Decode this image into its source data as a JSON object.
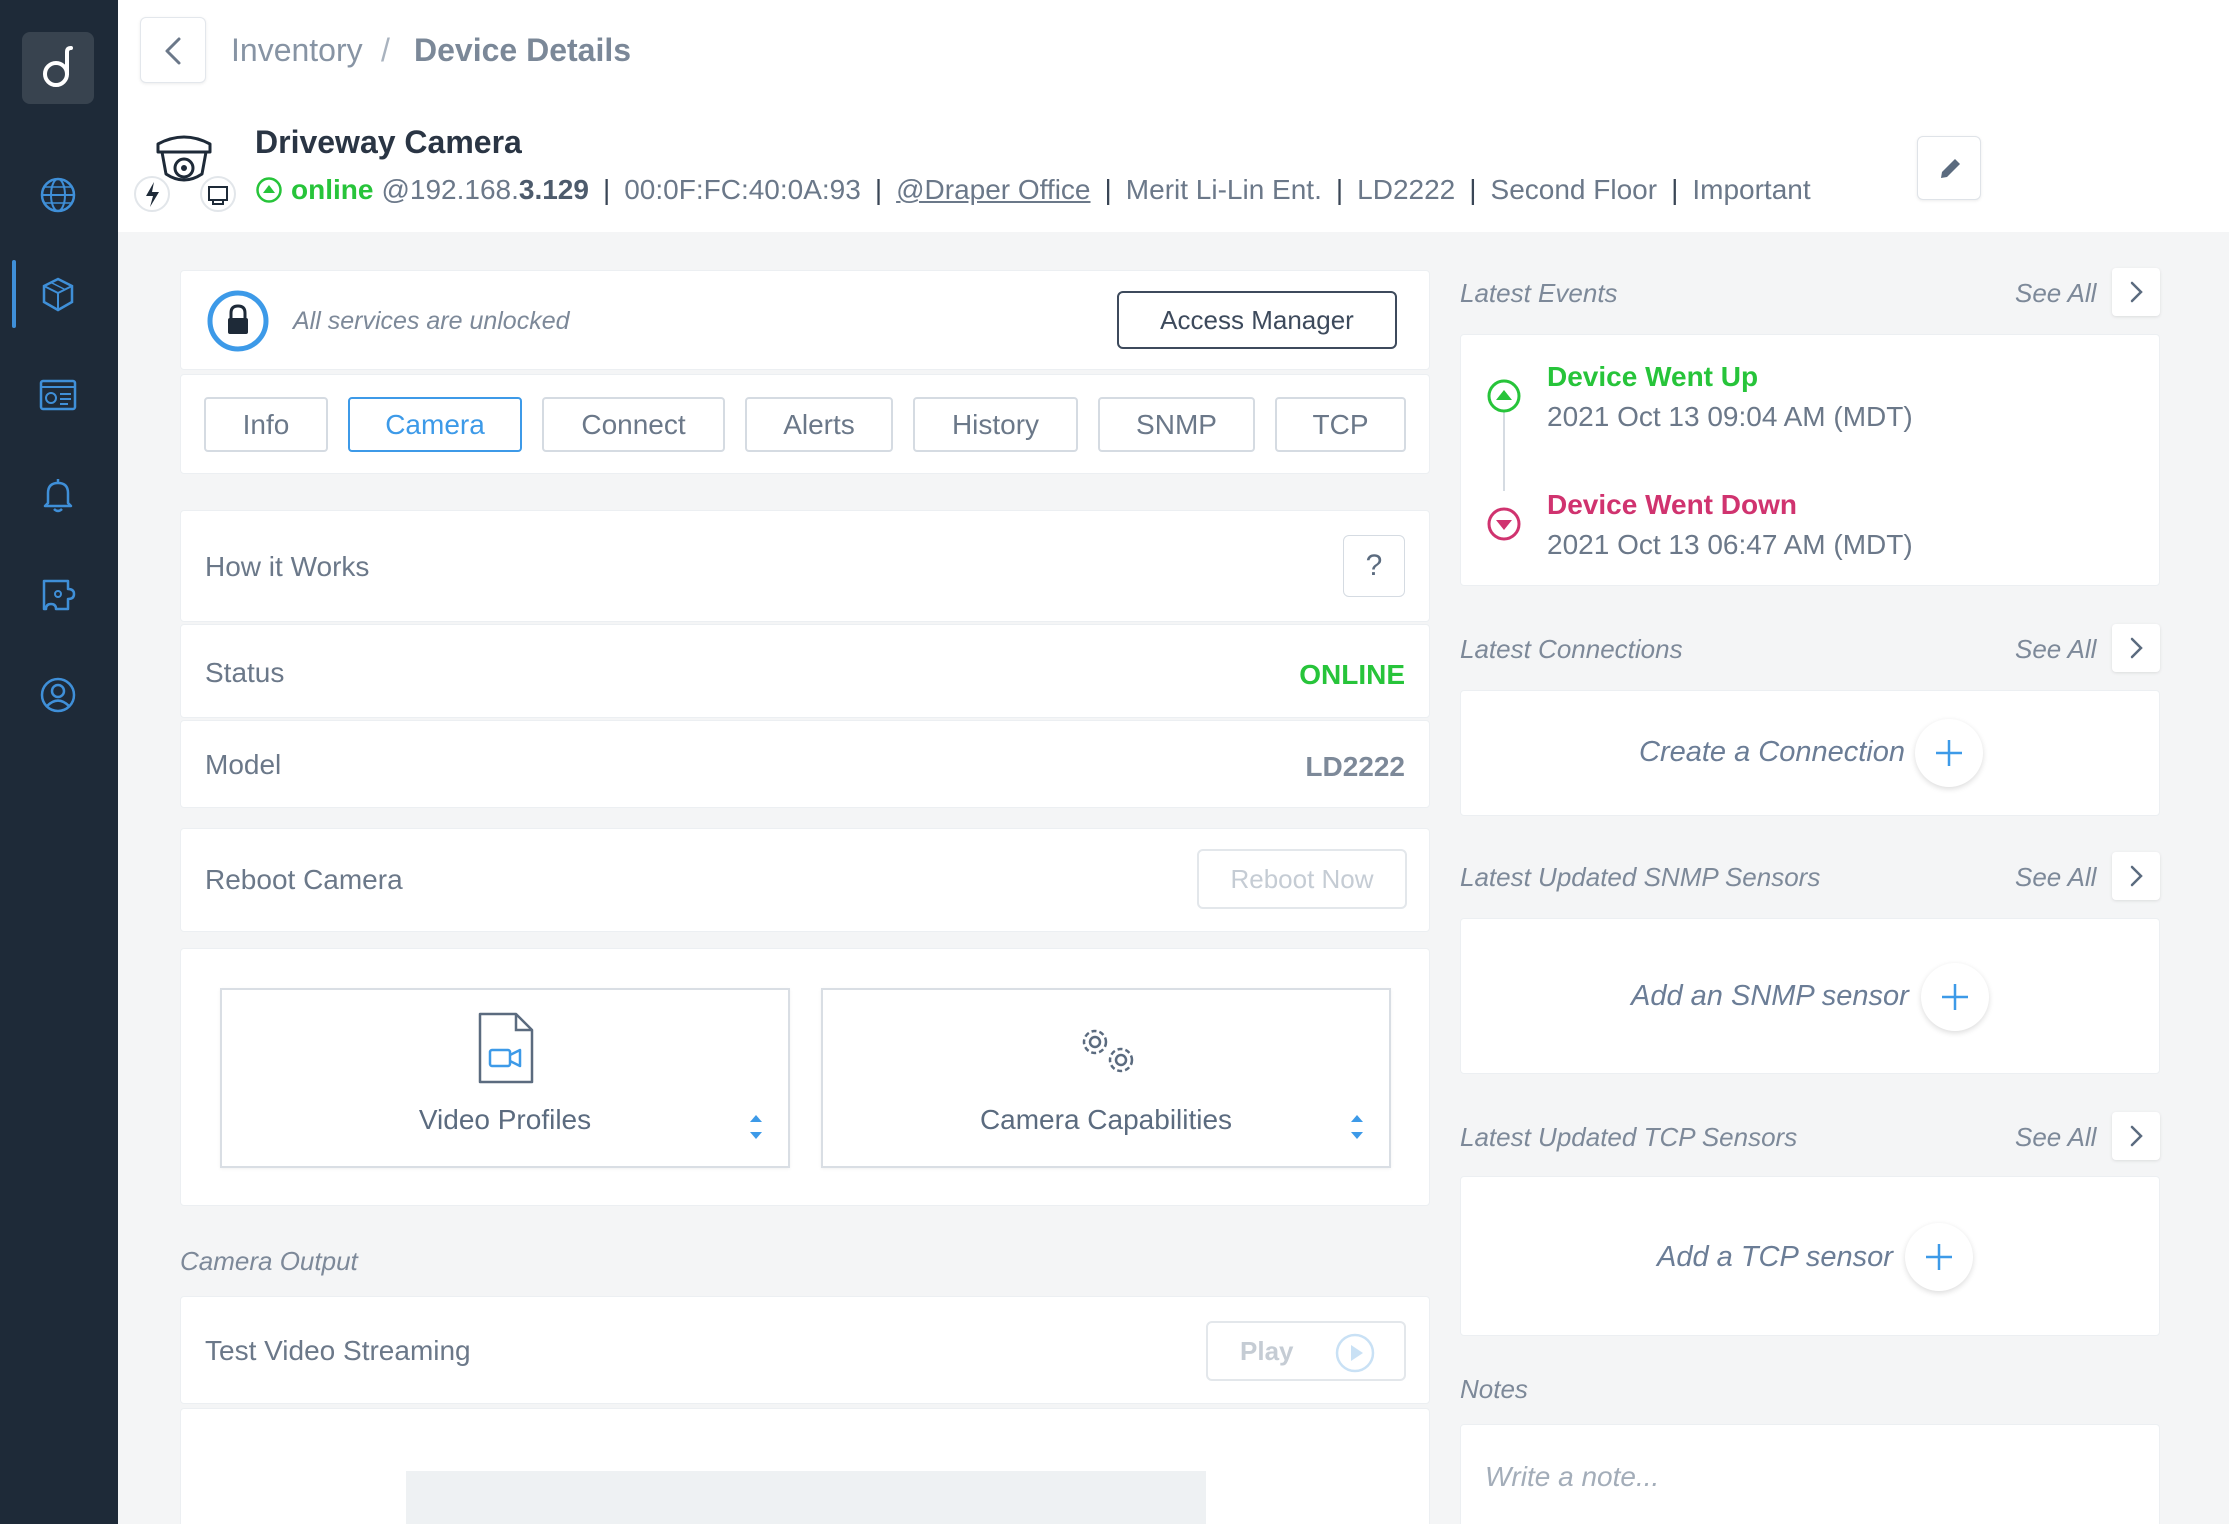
{
  "breadcrumb": {
    "parent": "Inventory",
    "separator": "/",
    "current": "Device Details"
  },
  "device": {
    "name": "Driveway Camera",
    "status": "online",
    "ip_prefix": "@192.168.",
    "ip_suffix": "3.129",
    "mac": "00:0F:FC:40:0A:93",
    "site": "@Draper Office",
    "vendor": "Merit Li-Lin Ent.",
    "model": "LD2222",
    "location": "Second Floor",
    "tag": "Important",
    "separator": "|"
  },
  "access": {
    "message": "All services are unlocked",
    "button": "Access Manager"
  },
  "tabs": [
    "Info",
    "Camera",
    "Connect",
    "Alerts",
    "History",
    "SNMP",
    "TCP"
  ],
  "active_tab": "Camera",
  "camera": {
    "how_it_works": "How it Works",
    "help_icon": "?",
    "status_label": "Status",
    "status_value": "ONLINE",
    "model_label": "Model",
    "model_value": "LD2222",
    "reboot_label": "Reboot Camera",
    "reboot_button": "Reboot Now",
    "video_profiles": "Video Profiles",
    "camera_capabilities": "Camera Capabilities",
    "output_title": "Camera Output",
    "test_streaming": "Test Video Streaming",
    "play_button": "Play"
  },
  "right": {
    "see_all": "See All",
    "events_title": "Latest Events",
    "events": [
      {
        "title": "Device Went Up",
        "time": "2021 Oct 13 09:04 AM (MDT)",
        "color": "#27c43a"
      },
      {
        "title": "Device Went Down",
        "time": "2021 Oct 13 06:47 AM (MDT)",
        "color": "#d0336f"
      }
    ],
    "connections_title": "Latest Connections",
    "connections_add": "Create a Connection",
    "snmp_title": "Latest Updated SNMP Sensors",
    "snmp_add": "Add an SNMP sensor",
    "tcp_title": "Latest Updated TCP Sensors",
    "tcp_add": "Add a TCP sensor",
    "notes_title": "Notes",
    "notes_placeholder": "Write a note..."
  },
  "colors": {
    "accent": "#3d9ae8",
    "online": "#27c43a",
    "down": "#d0336f",
    "sidebar": "#1e2a38"
  }
}
